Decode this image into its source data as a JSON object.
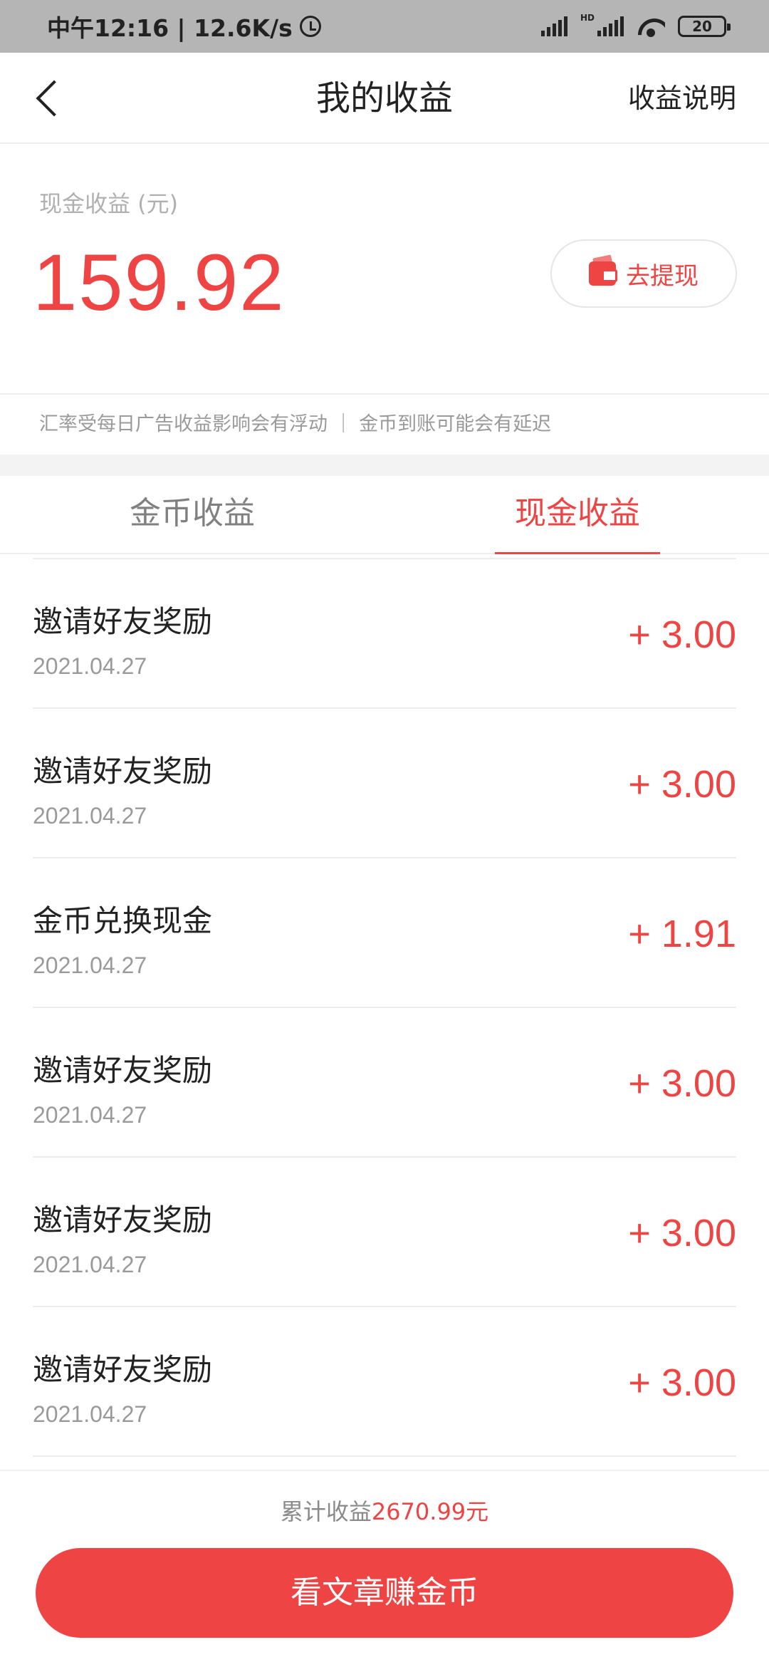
{
  "status_bar": {
    "time_speed": "中午12:16 | 12.6K/s",
    "network_badge": "HD",
    "battery": "20"
  },
  "nav": {
    "title": "我的收益",
    "right_link": "收益说明"
  },
  "balance": {
    "label": "现金收益 (元)",
    "value": "159.92",
    "withdraw_label": "去提现"
  },
  "notice": "汇率受每日广告收益影响会有浮动 ｜ 金币到账可能会有延迟",
  "tabs": [
    {
      "label": "金币收益",
      "active": false
    },
    {
      "label": "现金收益",
      "active": true
    }
  ],
  "records": [
    {
      "title": "邀请好友奖励",
      "date": "2021.04.27",
      "amount": "+ 3.00"
    },
    {
      "title": "邀请好友奖励",
      "date": "2021.04.27",
      "amount": "+ 3.00"
    },
    {
      "title": "金币兑换现金",
      "date": "2021.04.27",
      "amount": "+ 1.91"
    },
    {
      "title": "邀请好友奖励",
      "date": "2021.04.27",
      "amount": "+ 3.00"
    },
    {
      "title": "邀请好友奖励",
      "date": "2021.04.27",
      "amount": "+ 3.00"
    },
    {
      "title": "邀请好友奖励",
      "date": "2021.04.27",
      "amount": "+ 3.00"
    }
  ],
  "footer": {
    "total_label": "累计收益",
    "total_value": "2670.99元",
    "cta_label": "看文章赚金币"
  },
  "colors": {
    "accent": "#ef4444",
    "status_bar_bg": "#b5b5b5"
  }
}
